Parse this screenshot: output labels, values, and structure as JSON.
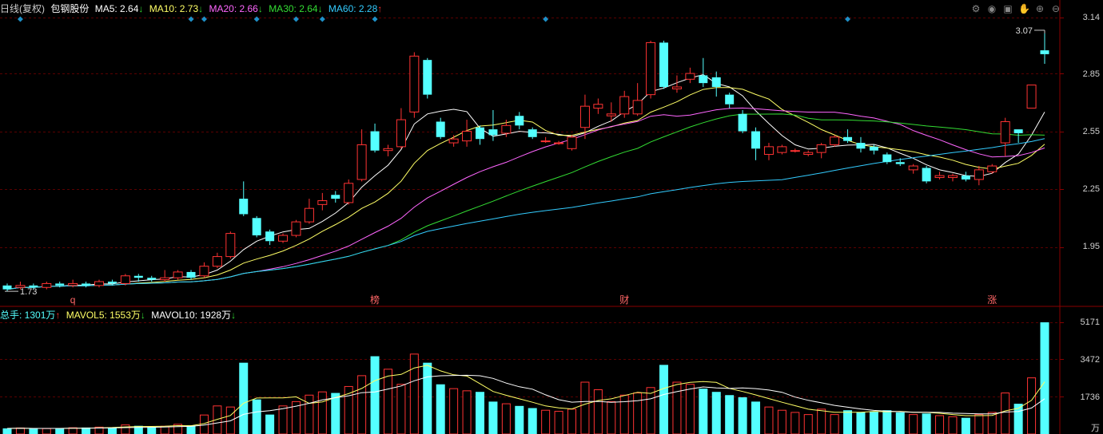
{
  "header": {
    "period": "日线(复权)",
    "stock_name": "包钢股份",
    "ma": [
      {
        "label": "MA5: 2.64",
        "arrow": "↓",
        "color": "#ffffff"
      },
      {
        "label": "MA10: 2.73",
        "arrow": "↓",
        "color": "#ffff66"
      },
      {
        "label": "MA20: 2.66",
        "arrow": "↓",
        "color": "#ff66ff"
      },
      {
        "label": "MA30: 2.64",
        "arrow": "↓",
        "color": "#33dd33"
      },
      {
        "label": "MA60: 2.28",
        "arrow": "↑",
        "color": "#33ccff"
      }
    ]
  },
  "vol_header": {
    "total": "总手: 1301万",
    "total_arrow": "↑",
    "mavol5": "MAVOL5: 1553万",
    "mavol5_arrow": "↓",
    "mavol10": "MAVOL10: 1928万",
    "mavol10_arrow": "↓"
  },
  "toolbar_icons": [
    "settings-icon",
    "eye-icon",
    "basket-icon",
    "hand-icon",
    "zoom-in-icon",
    "zoom-out-icon"
  ],
  "colors": {
    "up": "#ff3333",
    "down": "#54ffff",
    "grid": "#5a0000",
    "axis_text": "#d0d0d0"
  },
  "chart_data": {
    "type": "candlestick",
    "price_axis": {
      "ticks": [
        "3.14",
        "2.85",
        "2.55",
        "2.25",
        "1.95"
      ],
      "ylim": [
        1.65,
        3.14
      ]
    },
    "volume_axis": {
      "ticks": [
        "5171",
        "3472",
        "1736"
      ],
      "unit": "万"
    },
    "high_label": "3.07",
    "low_label": "1.73",
    "event_markers": [
      "q",
      "榜",
      "财",
      "涨"
    ],
    "candles": [
      [
        1.75,
        1.73,
        1.76,
        1.72,
        260
      ],
      [
        1.74,
        1.75,
        1.77,
        1.73,
        280
      ],
      [
        1.75,
        1.74,
        1.76,
        1.73,
        240
      ],
      [
        1.74,
        1.76,
        1.77,
        1.73,
        250
      ],
      [
        1.76,
        1.75,
        1.77,
        1.74,
        270
      ],
      [
        1.75,
        1.76,
        1.78,
        1.74,
        290
      ],
      [
        1.76,
        1.75,
        1.77,
        1.74,
        300
      ],
      [
        1.75,
        1.77,
        1.78,
        1.74,
        320
      ],
      [
        1.77,
        1.76,
        1.78,
        1.75,
        310
      ],
      [
        1.76,
        1.8,
        1.81,
        1.75,
        420
      ],
      [
        1.8,
        1.79,
        1.81,
        1.77,
        380
      ],
      [
        1.79,
        1.78,
        1.8,
        1.77,
        330
      ],
      [
        1.78,
        1.79,
        1.83,
        1.77,
        360
      ],
      [
        1.79,
        1.82,
        1.83,
        1.78,
        450
      ],
      [
        1.82,
        1.79,
        1.83,
        1.78,
        400
      ],
      [
        1.8,
        1.85,
        1.87,
        1.79,
        880
      ],
      [
        1.85,
        1.9,
        1.92,
        1.84,
        1300
      ],
      [
        1.9,
        2.02,
        2.03,
        1.89,
        1250
      ],
      [
        2.2,
        2.12,
        2.29,
        2.11,
        3300
      ],
      [
        2.1,
        2.01,
        2.11,
        2.0,
        1600
      ],
      [
        2.03,
        1.98,
        2.04,
        1.96,
        900
      ],
      [
        1.98,
        2.01,
        2.02,
        1.97,
        1300
      ],
      [
        2.01,
        2.08,
        2.09,
        2.0,
        1500
      ],
      [
        2.08,
        2.15,
        2.2,
        2.07,
        1800
      ],
      [
        2.17,
        2.19,
        2.23,
        2.14,
        1950
      ],
      [
        2.22,
        2.2,
        2.24,
        2.18,
        1900
      ],
      [
        2.18,
        2.28,
        2.3,
        2.17,
        2200
      ],
      [
        2.3,
        2.48,
        2.56,
        2.29,
        2700
      ],
      [
        2.55,
        2.45,
        2.59,
        2.44,
        3600
      ],
      [
        2.45,
        2.46,
        2.48,
        2.42,
        3000
      ],
      [
        2.47,
        2.61,
        2.67,
        2.46,
        2300
      ],
      [
        2.65,
        2.94,
        2.96,
        2.62,
        3700
      ],
      [
        2.92,
        2.74,
        2.93,
        2.72,
        3300
      ],
      [
        2.6,
        2.52,
        2.62,
        2.51,
        2300
      ],
      [
        2.49,
        2.51,
        2.53,
        2.47,
        2100
      ],
      [
        2.5,
        2.55,
        2.61,
        2.47,
        2000
      ],
      [
        2.57,
        2.51,
        2.58,
        2.48,
        1950
      ],
      [
        2.56,
        2.53,
        2.66,
        2.5,
        1500
      ],
      [
        2.54,
        2.58,
        2.61,
        2.52,
        1400
      ],
      [
        2.63,
        2.58,
        2.65,
        2.56,
        1300
      ],
      [
        2.56,
        2.52,
        2.57,
        2.51,
        1200
      ],
      [
        2.5,
        2.5,
        2.52,
        2.49,
        1100
      ],
      [
        2.49,
        2.49,
        2.5,
        2.48,
        1050
      ],
      [
        2.46,
        2.52,
        2.53,
        2.45,
        1150
      ],
      [
        2.57,
        2.68,
        2.74,
        2.51,
        2400
      ],
      [
        2.67,
        2.69,
        2.72,
        2.64,
        2050
      ],
      [
        2.63,
        2.64,
        2.7,
        2.6,
        1500
      ],
      [
        2.64,
        2.73,
        2.76,
        2.62,
        1800
      ],
      [
        2.64,
        2.71,
        2.8,
        2.63,
        1900
      ],
      [
        2.74,
        3.01,
        3.02,
        2.72,
        2150
      ],
      [
        3.01,
        2.78,
        3.02,
        2.77,
        3200
      ],
      [
        2.77,
        2.78,
        2.84,
        2.75,
        2400
      ],
      [
        2.82,
        2.85,
        2.88,
        2.8,
        2300
      ],
      [
        2.84,
        2.8,
        2.93,
        2.78,
        2100
      ],
      [
        2.83,
        2.78,
        2.86,
        2.73,
        1950
      ],
      [
        2.74,
        2.69,
        2.75,
        2.67,
        1800
      ],
      [
        2.64,
        2.55,
        2.66,
        2.54,
        1700
      ],
      [
        2.55,
        2.46,
        2.57,
        2.4,
        1500
      ],
      [
        2.43,
        2.47,
        2.49,
        2.4,
        1250
      ],
      [
        2.44,
        2.47,
        2.48,
        2.43,
        1100
      ],
      [
        2.45,
        2.45,
        2.46,
        2.44,
        1000
      ],
      [
        2.43,
        2.44,
        2.45,
        2.42,
        900
      ],
      [
        2.44,
        2.48,
        2.49,
        2.41,
        1150
      ],
      [
        2.48,
        2.52,
        2.53,
        2.47,
        900
      ],
      [
        2.52,
        2.5,
        2.56,
        2.49,
        1100
      ],
      [
        2.49,
        2.46,
        2.52,
        2.44,
        1000
      ],
      [
        2.47,
        2.45,
        2.48,
        2.43,
        1050
      ],
      [
        2.43,
        2.39,
        2.44,
        2.38,
        1100
      ],
      [
        2.39,
        2.38,
        2.41,
        2.37,
        1000
      ],
      [
        2.35,
        2.37,
        2.38,
        2.33,
        900
      ],
      [
        2.36,
        2.29,
        2.37,
        2.28,
        950
      ],
      [
        2.31,
        2.32,
        2.34,
        2.3,
        850
      ],
      [
        2.31,
        2.32,
        2.33,
        2.29,
        800
      ],
      [
        2.32,
        2.3,
        2.34,
        2.29,
        750
      ],
      [
        2.3,
        2.35,
        2.37,
        2.27,
        900
      ],
      [
        2.34,
        2.37,
        2.38,
        2.33,
        1000
      ],
      [
        2.49,
        2.6,
        2.62,
        2.42,
        1900
      ],
      [
        2.56,
        2.54,
        2.56,
        2.49,
        1400
      ],
      [
        2.67,
        2.79,
        2.79,
        2.69,
        2600
      ],
      [
        2.97,
        2.95,
        3.07,
        2.9,
        5171
      ]
    ]
  }
}
